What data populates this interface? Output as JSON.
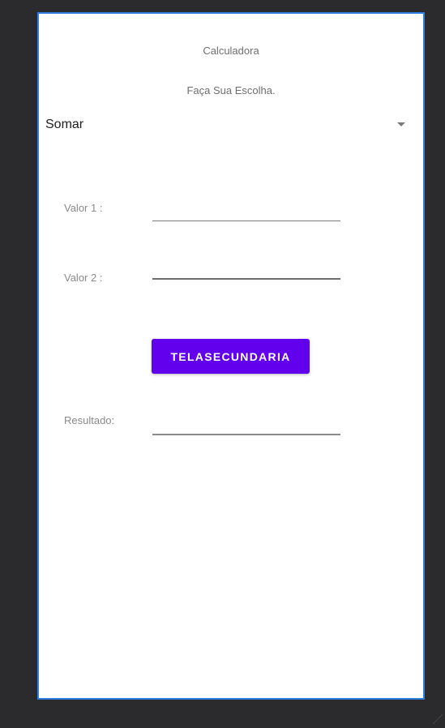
{
  "screen": {
    "title": "Calculadora",
    "subtitle": "Faça Sua Escolha.",
    "operation_spinner": {
      "selected": "Somar",
      "icon": "dropdown-arrow-icon"
    },
    "fields": {
      "value1_label": "Valor 1 :",
      "value1_input": "",
      "value2_label": "Valor 2 :",
      "value2_input": "",
      "result_label": "Resultado:",
      "result_input": ""
    },
    "action_button_label": "TELASECUNDARIA"
  },
  "colors": {
    "accent": "#6200ee",
    "frame_border": "#2f7fe0",
    "background": "#2b2b2d"
  }
}
